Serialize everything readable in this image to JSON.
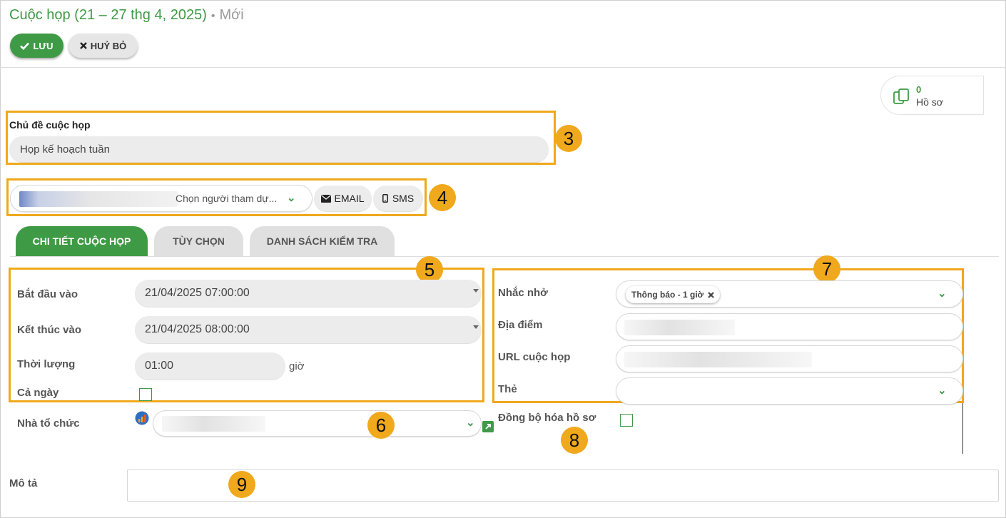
{
  "header": {
    "title": "Cuộc họp (21 – 27 thg 4, 2025)",
    "separator": "•",
    "status": "Mới"
  },
  "toolbar": {
    "save_label": "LƯU",
    "cancel_label": "HUỶ BỎ"
  },
  "records": {
    "count": "0",
    "label": "Hồ sơ"
  },
  "subject": {
    "label": "Chủ đề cuộc họp",
    "value": "Họp kế hoạch tuần"
  },
  "attendees": {
    "placeholder": "Chọn người tham dự...",
    "email_label": "EMAIL",
    "sms_label": "SMS"
  },
  "tabs": [
    {
      "label": "CHI TIẾT CUỘC HỌP",
      "active": true
    },
    {
      "label": "TÙY CHỌN",
      "active": false
    },
    {
      "label": "DANH SÁCH KIỂM TRA",
      "active": false
    }
  ],
  "details": {
    "start_label": "Bắt đầu vào",
    "start_value": "21/04/2025 07:00:00",
    "end_label": "Kết thúc vào",
    "end_value": "21/04/2025 08:00:00",
    "duration_label": "Thời lượng",
    "duration_value": "01:00",
    "duration_unit": "giờ",
    "allday_label": "Cả ngày",
    "organizer_label": "Nhà tổ chức"
  },
  "options": {
    "reminder_label": "Nhắc nhở",
    "reminder_chip": "Thông báo - 1 giờ",
    "location_label": "Địa điểm",
    "url_label": "URL cuộc họp",
    "tag_label": "Thẻ",
    "sync_label": "Đồng bộ hóa hồ sơ"
  },
  "description": {
    "label": "Mô tả"
  },
  "callouts": [
    "3",
    "4",
    "5",
    "6",
    "7",
    "8",
    "9"
  ],
  "colors": {
    "accent": "#3f9a46",
    "callout": "#f0a81c"
  }
}
